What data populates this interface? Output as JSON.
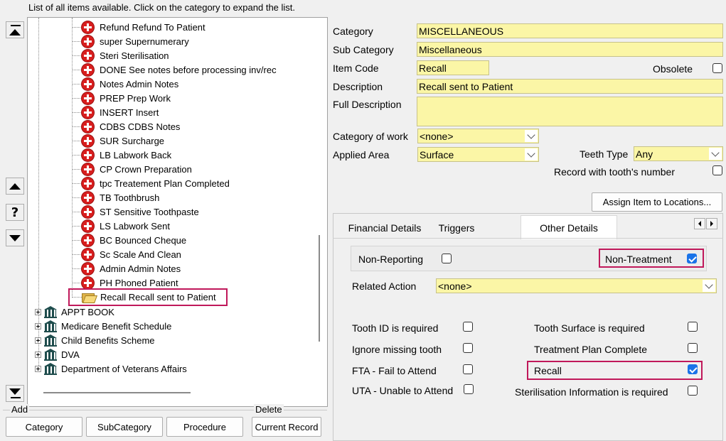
{
  "instructions": "List of all items available. Click on the category to expand the list.",
  "tree": {
    "items": [
      {
        "label": "Refund Refund To Patient"
      },
      {
        "label": "super Supernumerary"
      },
      {
        "label": "Steri Sterilisation"
      },
      {
        "label": "DONE See notes before processing inv/rec"
      },
      {
        "label": "Notes Admin Notes"
      },
      {
        "label": "PREP Prep Work"
      },
      {
        "label": "INSERT Insert"
      },
      {
        "label": "CDBS CDBS Notes"
      },
      {
        "label": "SUR Surcharge"
      },
      {
        "label": "LB Labwork Back"
      },
      {
        "label": "CP Crown Preparation"
      },
      {
        "label": "tpc Treatement Plan Completed"
      },
      {
        "label": "TB Toothbrush"
      },
      {
        "label": "ST Sensitive Toothpaste"
      },
      {
        "label": "LS Labwork Sent"
      },
      {
        "label": "BC Bounced Cheque"
      },
      {
        "label": "Sc Scale And Clean"
      },
      {
        "label": "Admin Admin Notes"
      },
      {
        "label": "PH Phoned Patient"
      }
    ],
    "selected_item": "Recall Recall sent to Patient",
    "categories": [
      {
        "label": "APPT BOOK"
      },
      {
        "label": "Medicare Benefit Schedule"
      },
      {
        "label": "Child Benefits Scheme"
      },
      {
        "label": "DVA"
      },
      {
        "label": "Department of Veterans Affairs"
      }
    ]
  },
  "bottom": {
    "add_label": "Add",
    "delete_label": "Delete",
    "category_btn": "Category",
    "subcategory_btn": "SubCategory",
    "procedure_btn": "Procedure",
    "current_record_btn": "Current Record"
  },
  "form": {
    "category_label": "Category",
    "category_value": "MISCELLANEOUS",
    "subcategory_label": "Sub Category",
    "subcategory_value": "Miscellaneous",
    "itemcode_label": "Item Code",
    "itemcode_value": "Recall",
    "obsolete_label": "Obsolete",
    "description_label": "Description",
    "description_value": "Recall sent to Patient",
    "fulldesc_label": "Full Description",
    "fulldesc_value": "",
    "catwork_label": "Category of work",
    "catwork_value": "<none>",
    "applied_label": "Applied Area",
    "applied_value": "Surface",
    "teethtype_label": "Teeth Type",
    "teethtype_value": "Any",
    "record_tooth_label": "Record with tooth's number",
    "assign_btn": "Assign Item to Locations..."
  },
  "tabs": {
    "financial": "Financial Details",
    "triggers": "Triggers",
    "other": "Other Details"
  },
  "other": {
    "non_reporting": "Non-Reporting",
    "non_treatment": "Non-Treatment",
    "related_action_label": "Related Action",
    "related_action_value": "<none>",
    "tooth_id": "Tooth ID is required",
    "tooth_surface": "Tooth Surface is required",
    "ignore_missing": "Ignore missing tooth",
    "tp_complete": "Treatment Plan Complete",
    "fta": "FTA - Fail to Attend",
    "recall": "Recall",
    "uta": "UTA - Unable to Attend",
    "steril_info": "Sterilisation Information is required"
  },
  "colors": {
    "field_yellow": "#fbf6a6",
    "highlight": "#c0185a",
    "checkbox_on": "#1a73e8"
  }
}
